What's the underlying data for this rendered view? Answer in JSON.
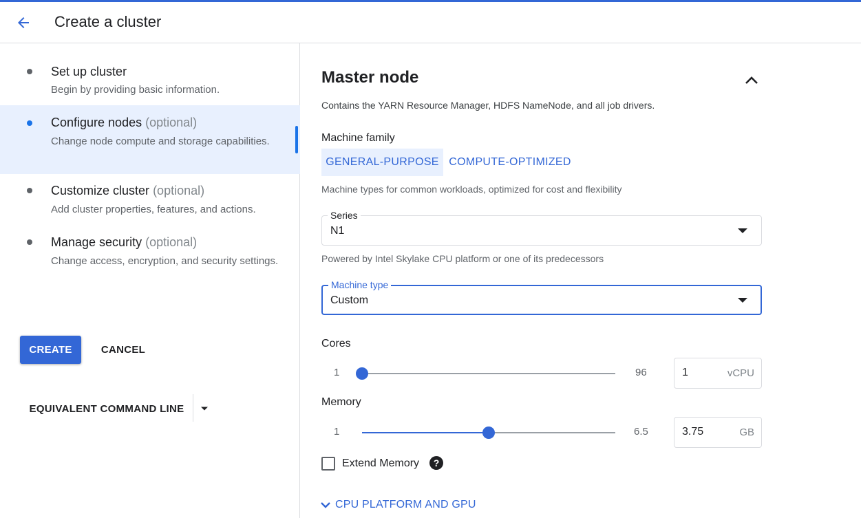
{
  "header": {
    "title": "Create a cluster"
  },
  "steps": [
    {
      "title": "Set up cluster",
      "optional": "",
      "desc": "Begin by providing basic information."
    },
    {
      "title": "Configure nodes",
      "optional": "(optional)",
      "desc": "Change node compute and storage capabilities."
    },
    {
      "title": "Customize cluster",
      "optional": "(optional)",
      "desc": "Add cluster properties, features, and actions."
    },
    {
      "title": "Manage security",
      "optional": "(optional)",
      "desc": "Change access, encryption, and security settings."
    }
  ],
  "actions": {
    "create": "CREATE",
    "cancel": "CANCEL",
    "command_line": "EQUIVALENT COMMAND LINE"
  },
  "master": {
    "title": "Master node",
    "desc": "Contains the YARN Resource Manager, HDFS NameNode, and all job drivers.",
    "machine_family_label": "Machine family",
    "tabs": [
      "GENERAL-PURPOSE",
      "COMPUTE-OPTIMIZED"
    ],
    "family_helper": "Machine types for common workloads, optimized for cost and flexibility",
    "series": {
      "label": "Series",
      "value": "N1",
      "helper": "Powered by Intel Skylake CPU platform or one of its predecessors"
    },
    "machine_type": {
      "label": "Machine type",
      "value": "Custom"
    },
    "cores": {
      "label": "Cores",
      "min": "1",
      "max": "96",
      "value": "1",
      "unit": "vCPU",
      "fraction": 0.0
    },
    "memory": {
      "label": "Memory",
      "min": "1",
      "max": "6.5",
      "value": "3.75",
      "unit": "GB",
      "fraction": 0.5
    },
    "extend_memory": {
      "label": "Extend Memory",
      "checked": false,
      "help_glyph": "?"
    },
    "expander": "CPU PLATFORM AND GPU"
  },
  "colors": {
    "accent": "#3367d6",
    "selected_bg": "#e8f0fe"
  }
}
